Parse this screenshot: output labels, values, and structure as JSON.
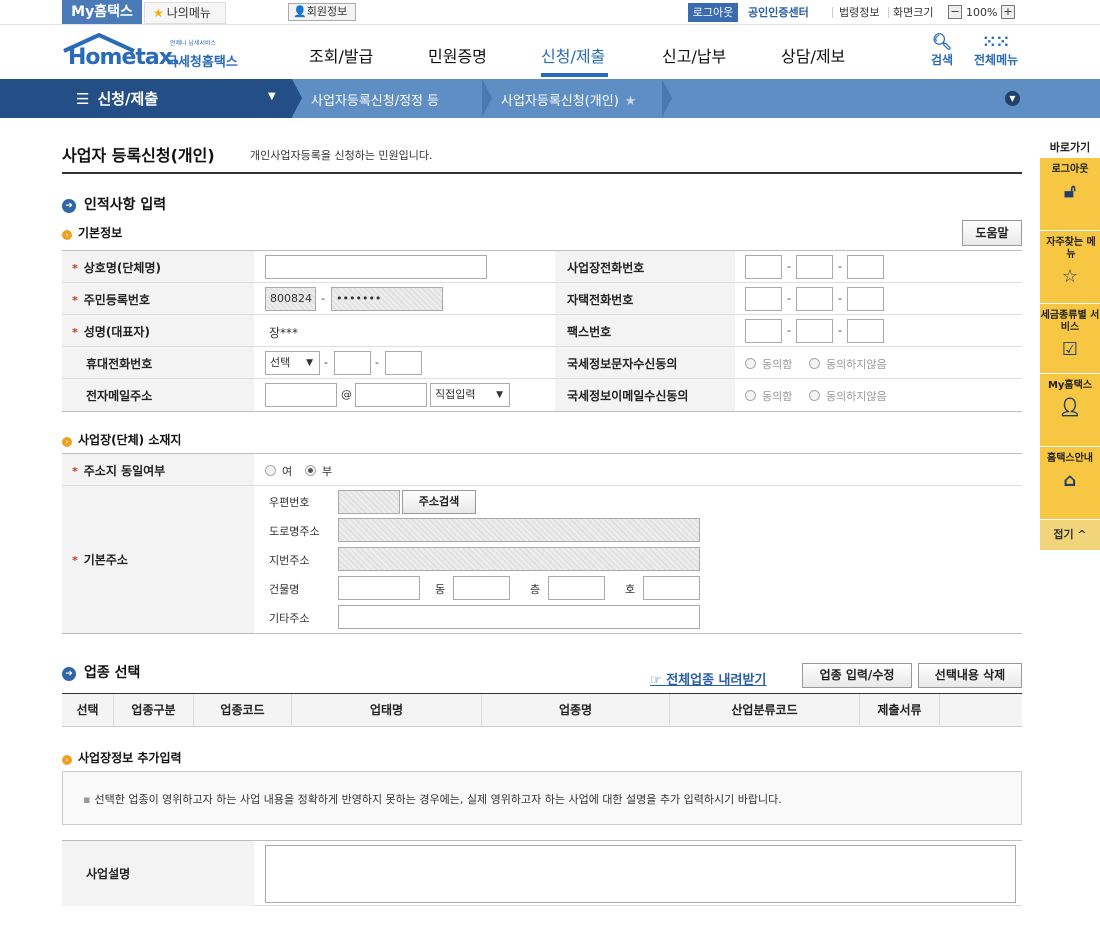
{
  "topbar": {
    "my_hometax": "My홈택스",
    "my_menu": "나의메뉴",
    "member_info": "회원정보",
    "logout": "로그아웃",
    "cert_center": "공인인증센터",
    "law_info": "법령정보",
    "screen_size": "화면크기",
    "zoom": "100%",
    "zoom_out": "−",
    "zoom_in": "+"
  },
  "header": {
    "logo_main": "Hometax.",
    "logo_sub": "국세청홈택스",
    "logo_tiny": "언제나 납세서비스",
    "gnb": [
      "조회/발급",
      "민원증명",
      "신청/제출",
      "신고/납부",
      "상담/제보"
    ],
    "active_gnb": "신청/제출",
    "search": "검색",
    "all_menu": "전체메뉴"
  },
  "location": {
    "first": "신청/제출",
    "crumb1": "사업자등록신청/정정 등",
    "crumb2": "사업자등록신청(개인)"
  },
  "quick": {
    "title": "바로가기",
    "items": [
      "로그아웃",
      "자주찾는 메뉴",
      "세금종류별 서비스",
      "My홈택스",
      "홈택스안내"
    ],
    "fold": "접기"
  },
  "page": {
    "title": "사업자 등록신청(개인)",
    "desc": "개인사업자등록을 신청하는 민원입니다."
  },
  "personal": {
    "section": "인적사항 입력",
    "basic": "기본정보",
    "help": "도움말",
    "labels": {
      "company": "상호명(단체명)",
      "rrn": "주민등록번호",
      "name": "성명(대표자)",
      "mobile": "휴대전화번호",
      "email": "전자메일주소",
      "biz_tel": "사업장전화번호",
      "home_tel": "자택전화번호",
      "fax": "팩스번호",
      "sms_agree": "국세정보문자수신동의",
      "email_agree": "국세정보이메일수신동의"
    },
    "rrn_front": "800824",
    "rrn_back": "•••••••",
    "name_value": "장***",
    "mobile_select": "선택",
    "email_at": "@",
    "email_domain": "직접입력",
    "agree": "동의함",
    "disagree": "동의하지않음",
    "dash": "-"
  },
  "address": {
    "section": "사업장(단체) 소재지",
    "same_label": "주소지 동일여부",
    "yes": "여",
    "no": "부",
    "base_label": "기본주소",
    "zip": "우편번호",
    "search_btn": "주소검색",
    "road": "도로명주소",
    "lot": "지번주소",
    "building": "건물명",
    "dong": "동",
    "floor": "층",
    "ho": "호",
    "etc": "기타주소"
  },
  "category": {
    "section": "업종 선택",
    "download": "전체업종 내려받기",
    "input_btn": "업종 입력/수정",
    "delete_btn": "선택내용 삭제",
    "columns": [
      "선택",
      "업종구분",
      "업종코드",
      "업태명",
      "업종명",
      "산업분류코드",
      "제출서류"
    ]
  },
  "extra": {
    "section": "사업장정보 추가입력",
    "notice": "선택한 업종이 영위하고자 하는 사업 내용을 정확하게 반영하지 못하는 경우에는, 실제 영위하고자 하는 사업에 대한 설명을 추가 입력하시기 바랍니다.",
    "desc_label": "사업설명"
  },
  "colors": {
    "brand": "#2a6bb8",
    "loc_dark": "#244e86",
    "loc_light": "#5f8ec4",
    "quick": "#f7c643",
    "required": "#c0392b"
  }
}
